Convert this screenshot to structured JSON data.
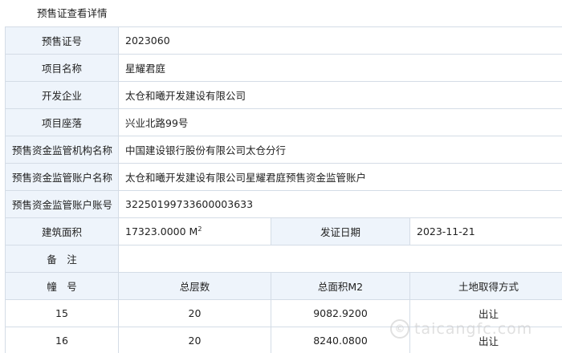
{
  "page_title": "预售证查看详情",
  "info": {
    "permit_no": {
      "label": "预售证号",
      "value": "2023060"
    },
    "project_name": {
      "label": "项目名称",
      "value": "星耀君庭"
    },
    "developer": {
      "label": "开发企业",
      "value": "太仓和曦开发建设有限公司"
    },
    "location": {
      "label": "项目座落",
      "value": "兴业北路99号"
    },
    "supervisor": {
      "label": "预售资金监管机构名称",
      "value": "中国建设银行股份有限公司太仓分行"
    },
    "account_name": {
      "label": "预售资金监管账户名称",
      "value": "太仓和曦开发建设有限公司星耀君庭预售资金监管账户"
    },
    "account_no": {
      "label": "预售资金监管账户账号",
      "value": "32250199733600003633"
    },
    "area": {
      "label": "建筑面积",
      "value": "17323.0000 M",
      "unit_sup": "2"
    },
    "issue_date": {
      "label": "发证日期",
      "value": "2023-11-21"
    },
    "remarks": {
      "label": "备　注",
      "value": ""
    }
  },
  "buildings": {
    "headers": [
      "幢　号",
      "总层数",
      "总面积M2",
      "土地取得方式"
    ],
    "rows": [
      [
        "15",
        "20",
        "9082.9200",
        "出让"
      ],
      [
        "16",
        "20",
        "8240.0800",
        "出让"
      ]
    ]
  },
  "watermark": {
    "icon": "copyright-circle-icon",
    "glyph": "©",
    "text": "taicangfc.com"
  },
  "colors": {
    "label_bg": "#eef4fb",
    "border": "#d4dce6"
  }
}
